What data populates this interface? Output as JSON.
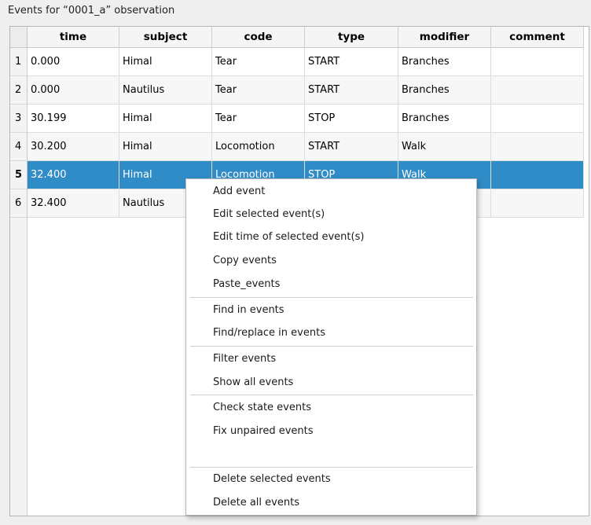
{
  "window": {
    "title": "Events for “0001_a” observation"
  },
  "table": {
    "columns": [
      "time",
      "subject",
      "code",
      "type",
      "modifier",
      "comment"
    ],
    "rows": [
      {
        "num": "1",
        "time": "0.000",
        "subject": "Himal",
        "code": "Tear",
        "type": "START",
        "modifier": "Branches",
        "comment": ""
      },
      {
        "num": "2",
        "time": "0.000",
        "subject": "Nautilus",
        "code": "Tear",
        "type": "START",
        "modifier": "Branches",
        "comment": ""
      },
      {
        "num": "3",
        "time": "30.199",
        "subject": "Himal",
        "code": "Tear",
        "type": "STOP",
        "modifier": "Branches",
        "comment": ""
      },
      {
        "num": "4",
        "time": "30.200",
        "subject": "Himal",
        "code": "Locomotion",
        "type": "START",
        "modifier": "Walk",
        "comment": ""
      },
      {
        "num": "5",
        "time": "32.400",
        "subject": "Himal",
        "code": "Locomotion",
        "type": "STOP",
        "modifier": "Walk",
        "comment": ""
      },
      {
        "num": "6",
        "time": "32.400",
        "subject": "Nautilus",
        "code": "",
        "type": "",
        "modifier": "",
        "comment": ""
      }
    ],
    "selected_row": 5,
    "selection_color": "#308cc6"
  },
  "context_menu": {
    "items": [
      "Add event",
      "Edit selected event(s)",
      "Edit time of selected event(s)",
      "Copy events",
      "Paste_events",
      "Find in events",
      "Find/replace in events",
      "Filter events",
      "Show all events",
      "Check state events",
      "Fix unpaired events",
      "",
      "Delete selected events",
      "Delete all events"
    ]
  }
}
